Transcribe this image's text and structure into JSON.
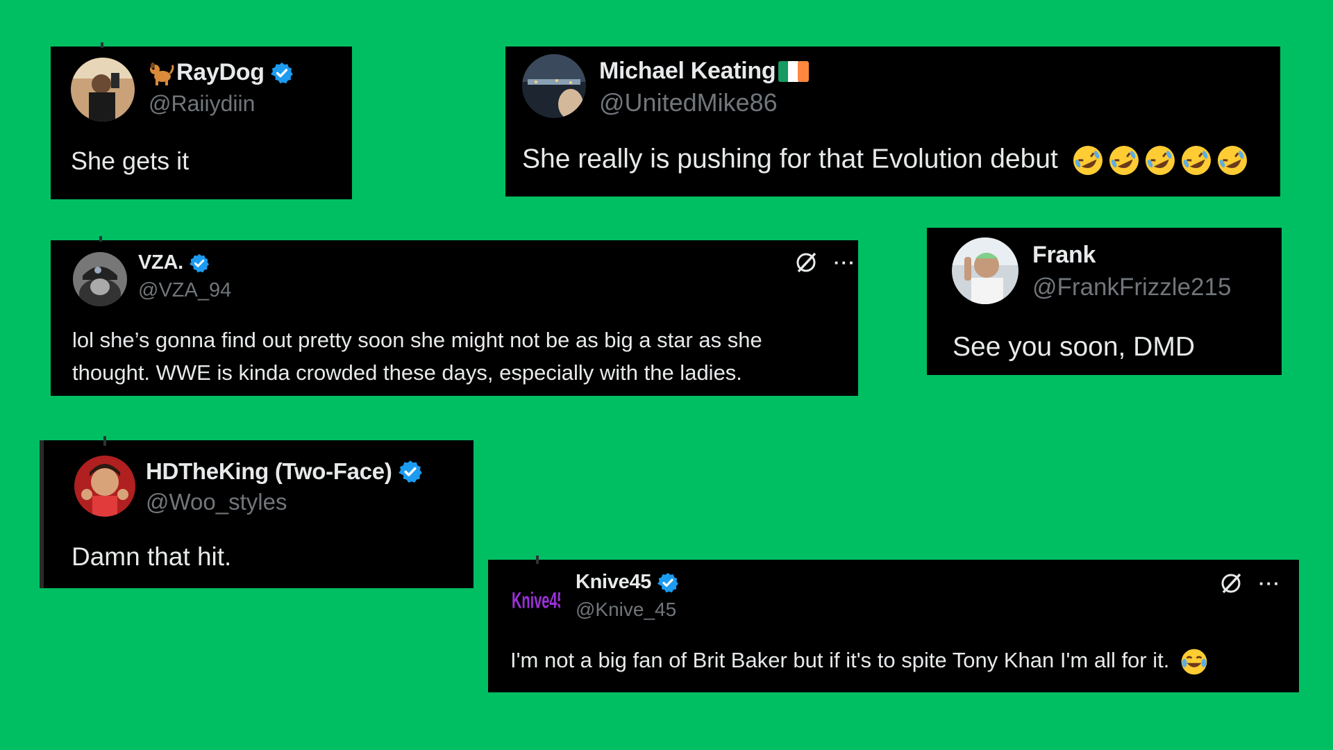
{
  "tweets": [
    {
      "name": "RayDog",
      "name_prefix_emoji": "dog",
      "verified": true,
      "handle": "@Raiiydiin",
      "text": "She gets it"
    },
    {
      "name": "Michael Keating",
      "name_suffix_flag": "ireland-flag",
      "verified": false,
      "handle": "@UnitedMike86",
      "text": "She really is pushing for that Evolution debut"
    },
    {
      "name": "VZA.",
      "verified": true,
      "handle": "@VZA_94",
      "text_line1": "lol she’s gonna find out pretty soon she might not be as big a star as she",
      "text_line2": "thought. WWE is kinda crowded these days, especially with the ladies.",
      "more": "···"
    },
    {
      "name": "Frank",
      "verified": false,
      "handle": "@FrankFrizzle215",
      "text": "See you soon, DMD"
    },
    {
      "name": "HDTheKing (Two-Face)",
      "verified": true,
      "handle": "@Woo_styles",
      "text": "Damn that hit."
    },
    {
      "name": "Knive45",
      "verified": true,
      "handle": "@Knive_45",
      "avatar_text": "Knive45",
      "text": "I'm not a big fan of Brit Baker but if it's to spite Tony Khan I'm all for it.",
      "more": "···"
    }
  ],
  "colors": {
    "background": "#00bf63",
    "card": "#000000",
    "verified": "#1d9bf0",
    "handle": "#71767b",
    "text": "#e7e9ea",
    "avatar_text": "#9b30d9"
  }
}
